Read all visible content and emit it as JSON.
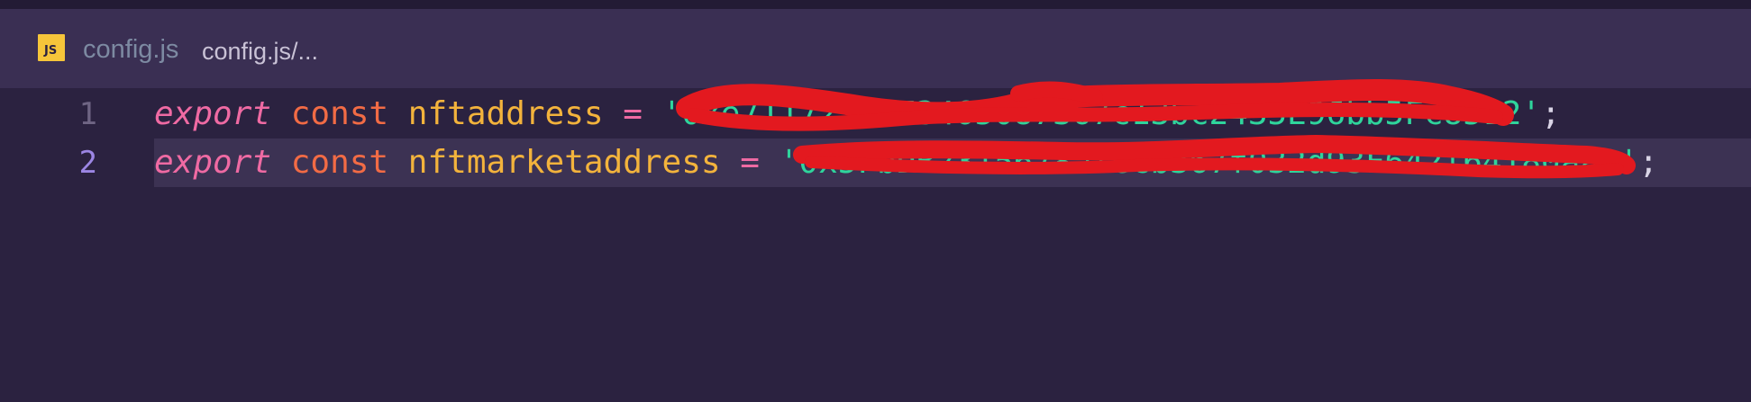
{
  "breadcrumb": {
    "file_icon_label": "JS",
    "file_name": "config.js",
    "path": "config.js/..."
  },
  "editor": {
    "lines": [
      {
        "number": "1",
        "tokens": {
          "export": "export",
          "const": "const",
          "name": "nftaddress",
          "equals": "=",
          "quote_open": "'",
          "value": "0xe7117255773465087367c13bc2435E96bb5Fc8512",
          "quote_close": "'",
          "semicolon": ";"
        }
      },
      {
        "number": "2",
        "tokens": {
          "export": "export",
          "const": "const",
          "name": "nftmarketaddress",
          "equals": "=",
          "quote_open": "'",
          "value": "0x5FbDB2315678afecb367f032d93F642f64180aa3",
          "quote_close": "'",
          "semicolon": ";"
        }
      }
    ]
  },
  "colors": {
    "background": "#2b2240",
    "breadcrumb_bar": "#3a2f53",
    "keyword_export": "#ef6aa3",
    "keyword_const": "#f26b45",
    "identifier": "#f3b33c",
    "string": "#2fd59c",
    "redaction": "#e3191f"
  }
}
